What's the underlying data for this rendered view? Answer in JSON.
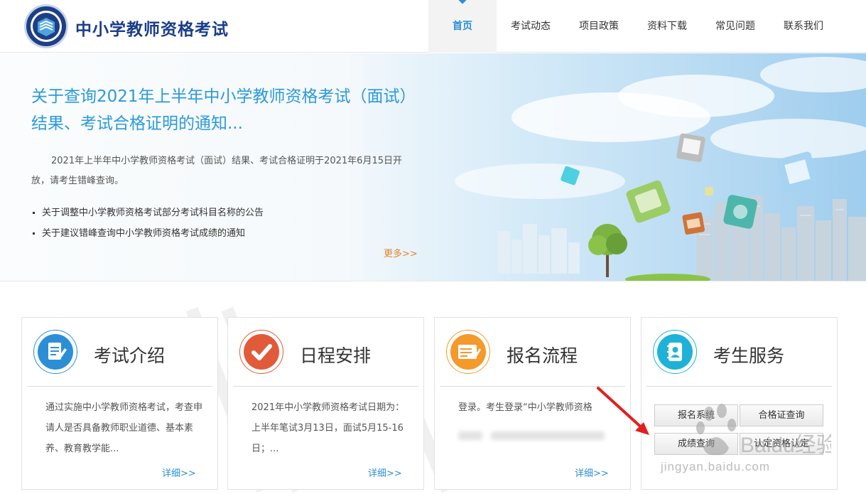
{
  "header": {
    "site_title": "中小学教师资格考试",
    "logo_icon": "exam-logo-icon",
    "nav": [
      {
        "label": "首页",
        "active": true
      },
      {
        "label": "考试动态"
      },
      {
        "label": "项目政策"
      },
      {
        "label": "资料下载"
      },
      {
        "label": "常见问题"
      },
      {
        "label": "联系我们"
      }
    ]
  },
  "banner": {
    "news_title": "关于查询2021年上半年中小学教师资格考试（面试）结果、考试合格证明的通知...",
    "summary": "2021年上半年中小学教师资格考试（面试）结果、考试合格证明于2021年6月15日开放，请考生错峰查询。",
    "links": [
      "关于调整中小学教师资格考试部分考试科目名称的公告",
      "关于建议错峰查询中小学教师资格考试成绩的通知"
    ],
    "more": "更多>>"
  },
  "cards": [
    {
      "title": "考试介绍",
      "icon": "document-edit-icon",
      "color": "#2c8fd6",
      "body": "通过实施中小学教师资格考试，考查申请人是否具备教师职业道德、基本素养、教育教学能...",
      "more": "详细>>"
    },
    {
      "title": "日程安排",
      "icon": "checkmark-icon",
      "color": "#e15b3a",
      "body": "2021年中小学教师资格考试日期为：上半年笔试3月13日，面试5月15-16日；...",
      "more": "详细>>"
    },
    {
      "title": "报名流程",
      "icon": "form-pen-icon",
      "color": "#f39a2b",
      "body": "登录。考生登录“中小学教师资格",
      "more": "详细>>"
    },
    {
      "title": "考生服务",
      "icon": "contact-book-icon",
      "color": "#1fb2d8",
      "buttons": [
        "报名系统",
        "合格证查询",
        "成绩查询",
        "认定资格认定"
      ]
    }
  ],
  "watermark": {
    "text": "jingyan.baidu.com",
    "brand": "Baidu经验"
  },
  "colors": {
    "primary": "#2c8fd6",
    "brand_blue": "#1a3c8a",
    "orange_link": "#e4832b"
  }
}
